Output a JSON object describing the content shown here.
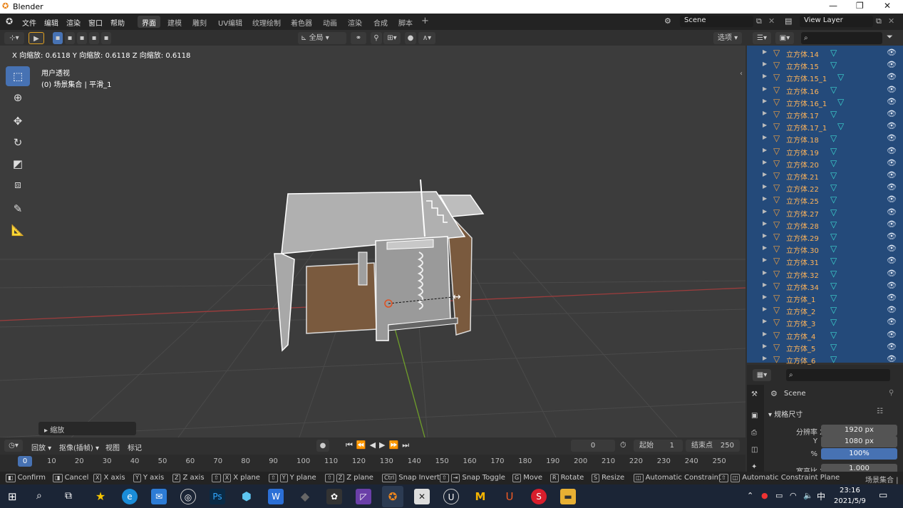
{
  "window": {
    "title": "Blender"
  },
  "menus": [
    "文件",
    "编辑",
    "渲染",
    "窗口",
    "帮助"
  ],
  "workspace_tabs": [
    "界面",
    "建模",
    "雕刻",
    "UV编辑",
    "纹理绘制",
    "着色器",
    "动画",
    "渲染",
    "合成",
    "脚本"
  ],
  "active_tab_index": 0,
  "scene": {
    "label": "Scene",
    "view_layer": "View Layer"
  },
  "viewport_header": {
    "orientation": "全局",
    "options": "选项"
  },
  "operator_readout": "X 向缩放: 0.6118  Y 向缩放: 0.6118  Z 向缩放: 0.6118",
  "viewport": {
    "view_name": "用户透视",
    "collection_info": "(0) 场景集合 | 平滑_1",
    "last_op_panel": "缩放"
  },
  "outliner": {
    "items": [
      {
        "name": "立方体.14"
      },
      {
        "name": "立方体.15"
      },
      {
        "name": "立方体.15_1"
      },
      {
        "name": "立方体.16"
      },
      {
        "name": "立方体.16_1"
      },
      {
        "name": "立方体.17"
      },
      {
        "name": "立方体.17_1"
      },
      {
        "name": "立方体.18"
      },
      {
        "name": "立方体.19"
      },
      {
        "name": "立方体.20"
      },
      {
        "name": "立方体.21"
      },
      {
        "name": "立方体.22"
      },
      {
        "name": "立方体.25"
      },
      {
        "name": "立方体.27"
      },
      {
        "name": "立方体.28"
      },
      {
        "name": "立方体.29"
      },
      {
        "name": "立方体.30"
      },
      {
        "name": "立方体.31"
      },
      {
        "name": "立方体.32"
      },
      {
        "name": "立方体.34"
      },
      {
        "name": "立方体_1"
      },
      {
        "name": "立方体_2"
      },
      {
        "name": "立方体_3"
      },
      {
        "name": "立方体_4"
      },
      {
        "name": "立方体_5"
      },
      {
        "name": "立方体_6"
      }
    ]
  },
  "properties": {
    "scene": "Scene",
    "section": "规格尺寸",
    "res_x_label": "分辨率 X",
    "res_x": "1920 px",
    "res_y_label": "Y",
    "res_y": "1080 px",
    "pct_label": "%",
    "pct": "100%",
    "aspect_label": "宽高比 X",
    "aspect": "1.000"
  },
  "timeline": {
    "playback": "回放",
    "keying": "抠像(插帧)",
    "view": "视图",
    "marker": "标记",
    "current_frame": "0",
    "start_label": "起始",
    "start": "1",
    "end_label": "结束点",
    "end": "250",
    "cursor_frame": "0",
    "ticks": [
      "10",
      "20",
      "30",
      "40",
      "50",
      "60",
      "70",
      "80",
      "90",
      "100",
      "110",
      "120",
      "130",
      "140",
      "150",
      "160",
      "170",
      "180",
      "190",
      "200",
      "210",
      "220",
      "230",
      "240",
      "250"
    ]
  },
  "statusbar": {
    "confirm": "Confirm",
    "cancel": "Cancel",
    "x_axis": "X axis",
    "y_axis": "Y axis",
    "z_axis": "Z axis",
    "x_plane": "X plane",
    "y_plane": "Y plane",
    "z_plane": "Z plane",
    "snap_invert": "Snap Invert",
    "snap_toggle": "Snap Toggle",
    "move": "Move",
    "rotate": "Rotate",
    "resize": "Resize",
    "auto_constraint": "Automatic Constraint",
    "auto_constraint_plane": "Automatic Constraint Plane",
    "right_text": "场景集合 | 平"
  },
  "taskbar": {
    "time": "23:16",
    "date": "2021/5/9",
    "ime": "中"
  },
  "colors": {
    "accent": "#4772b3",
    "outliner_bg": "#244a7a",
    "object_name": "#ffb45a",
    "mesh_icon": "#3dd6d0"
  }
}
